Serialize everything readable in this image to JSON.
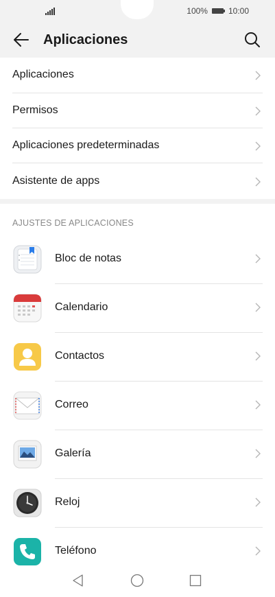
{
  "status_bar": {
    "battery": "100%",
    "time": "10:00"
  },
  "header": {
    "title": "Aplicaciones"
  },
  "settings_list": [
    {
      "label": "Aplicaciones"
    },
    {
      "label": "Permisos"
    },
    {
      "label": "Aplicaciones predeterminadas"
    },
    {
      "label": "Asistente de apps"
    }
  ],
  "app_settings": {
    "section_title": "AJUSTES DE APLICACIONES",
    "apps": [
      {
        "label": "Bloc de notas",
        "icon": "notepad-icon"
      },
      {
        "label": "Calendario",
        "icon": "calendar-icon"
      },
      {
        "label": "Contactos",
        "icon": "contacts-icon"
      },
      {
        "label": "Correo",
        "icon": "mail-icon"
      },
      {
        "label": "Galería",
        "icon": "gallery-icon"
      },
      {
        "label": "Reloj",
        "icon": "clock-icon"
      },
      {
        "label": "Teléfono",
        "icon": "phone-icon"
      }
    ]
  },
  "colors": {
    "background": "#f2f2f2",
    "card": "#ffffff",
    "divider": "#e3e3e3",
    "secondary_text": "#888888"
  }
}
